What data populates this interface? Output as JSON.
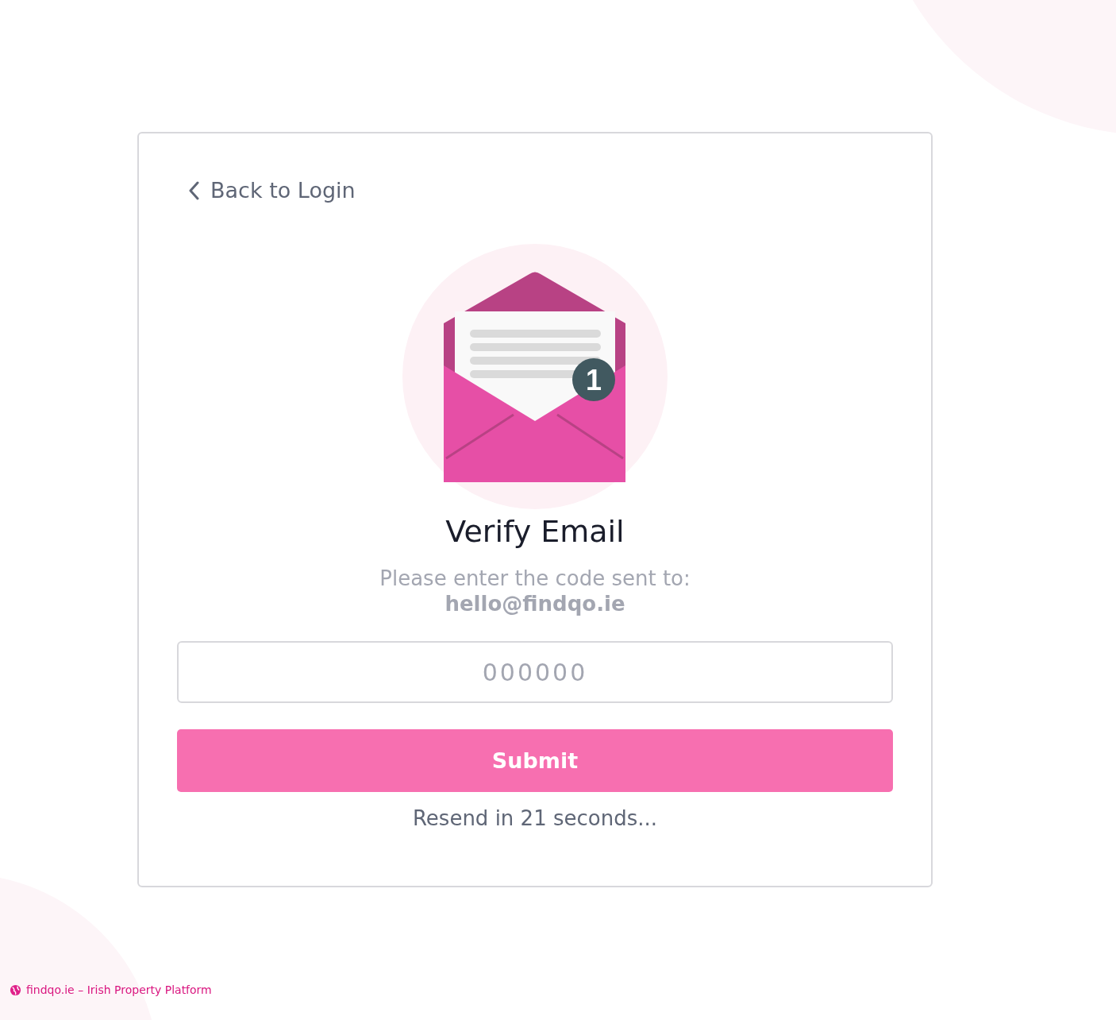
{
  "back_link": {
    "label": "Back to Login"
  },
  "illustration": {
    "badge_count": "1"
  },
  "title": "Verify Email",
  "subtitle": "Please enter the code sent to:",
  "email": "hello@findqo.ie",
  "code_field": {
    "placeholder": "000000"
  },
  "submit_button": {
    "label": "Submit"
  },
  "resend_note": "Resend in 21 seconds...",
  "footer": {
    "text": "findqo.ie – Irish Property Platform"
  }
}
